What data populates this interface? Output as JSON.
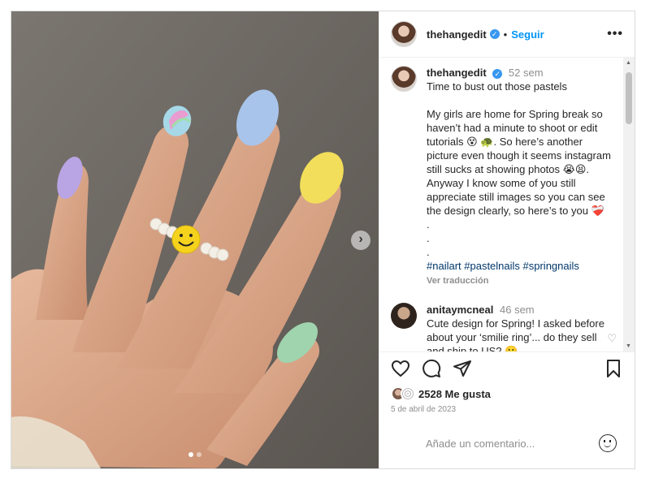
{
  "post": {
    "username": "thehangedit",
    "separator": "•",
    "follow_label": "Seguir",
    "more_label": "•••"
  },
  "caption": {
    "username": "thehangedit",
    "time": "52 sem",
    "text": "Time to bust out those pastels\n\nMy girls are home for Spring break so haven’t had a minute to shoot or edit tutorials 😵 🐢. So here’s another picture even though it seems instagram still sucks at showing photos 😭😫. Anyway I know some of you still appreciate still images so you can see the design clearly, so here’s to you ❤️‍🩹\n.\n.\n.",
    "hashtags": "#nailart #pastelnails #springnails",
    "translate": "Ver traducción"
  },
  "comments": [
    {
      "username": "anitaymcneal",
      "time": "46 sem",
      "text": "Cute design for Spring! I asked before about your ‘smilie ring’... do they sell and ship to US? 🙁"
    }
  ],
  "likes": {
    "count_text": "2528 Me gusta"
  },
  "date": "5 de abril de 2023",
  "add_comment": {
    "placeholder": "Añade un comentario..."
  },
  "icons": {
    "like": "heart-icon",
    "comment": "comment-icon",
    "share": "send-icon",
    "save": "bookmark-icon",
    "emoji": "emoji-icon",
    "next": "chevron-right-icon"
  },
  "colors": {
    "link_blue": "#0095f6",
    "verified_blue": "#3897f0",
    "hashtag": "#00376b"
  }
}
